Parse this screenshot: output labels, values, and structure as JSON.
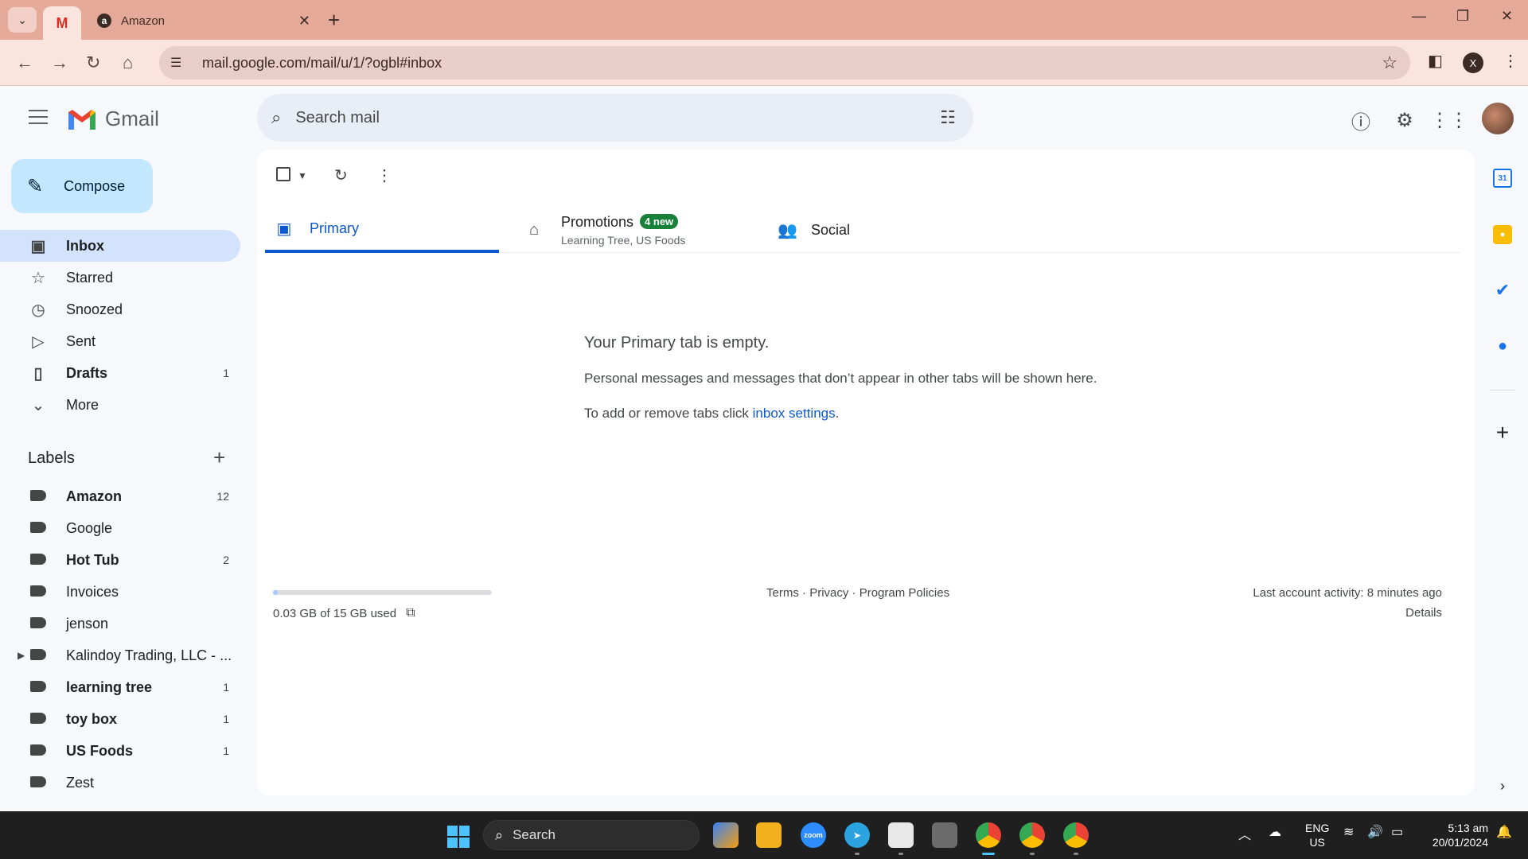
{
  "browser": {
    "tabs": [
      {
        "label": "",
        "favicon": "gmail-icon",
        "active": true
      },
      {
        "label": "Amazon",
        "favicon": "amazon-icon",
        "active": false
      }
    ],
    "url": "mail.google.com/mail/u/1/?ogbl#inbox",
    "profile_initial": "X"
  },
  "gmail": {
    "brand": "Gmail",
    "search_placeholder": "Search mail",
    "compose_label": "Compose",
    "nav": [
      {
        "label": "Inbox",
        "icon": "inbox-icon",
        "count": "",
        "active": true
      },
      {
        "label": "Starred",
        "icon": "star-icon",
        "count": ""
      },
      {
        "label": "Snoozed",
        "icon": "clock-icon",
        "count": ""
      },
      {
        "label": "Sent",
        "icon": "send-icon",
        "count": ""
      },
      {
        "label": "Drafts",
        "icon": "draft-icon",
        "count": "1"
      },
      {
        "label": "More",
        "icon": "chevron-down-icon",
        "count": ""
      }
    ],
    "labels_heading": "Labels",
    "labels": [
      {
        "label": "Amazon",
        "count": "12",
        "bold": true
      },
      {
        "label": "Google",
        "count": ""
      },
      {
        "label": "Hot Tub",
        "count": "2",
        "bold": true
      },
      {
        "label": "Invoices",
        "count": ""
      },
      {
        "label": "jenson",
        "count": ""
      },
      {
        "label": "Kalindoy Trading, LLC - ...",
        "count": "",
        "expandable": true
      },
      {
        "label": "learning tree",
        "count": "1",
        "bold": true
      },
      {
        "label": "toy box",
        "count": "1",
        "bold": true
      },
      {
        "label": "US Foods",
        "count": "1",
        "bold": true
      },
      {
        "label": "Zest",
        "count": ""
      }
    ],
    "category_tabs": {
      "primary": "Primary",
      "promotions": {
        "label": "Promotions",
        "badge": "4 new",
        "senders": "Learning Tree, US Foods"
      },
      "social": "Social"
    },
    "empty_state": {
      "title": "Your Primary tab is empty.",
      "body": "Personal messages and messages that don’t appear in other tabs will be shown here.",
      "hint_prefix": "To add or remove tabs click ",
      "hint_link": "inbox settings",
      "hint_suffix": "."
    },
    "storage": {
      "text": "0.03 GB of 15 GB used",
      "used_fraction": 0.002
    },
    "footer": {
      "terms": "Terms",
      "privacy": "Privacy",
      "policies": "Program Policies",
      "sep": " · "
    },
    "activity": {
      "text": "Last account activity: 8 minutes ago",
      "details": "Details"
    }
  },
  "side_panel": {
    "calendar_day": "31"
  },
  "taskbar": {
    "search_label": "Search",
    "lang_line1": "ENG",
    "lang_line2": "US",
    "time": "5:13 am",
    "date": "20/01/2024",
    "zoom_label": "zoom"
  },
  "colors": {
    "accent": "#0b57d0",
    "compose_bg": "#c2e7ff",
    "active_nav": "#d3e3fd",
    "badge": "#188038",
    "chrome_tabstrip": "#e5a99a"
  }
}
